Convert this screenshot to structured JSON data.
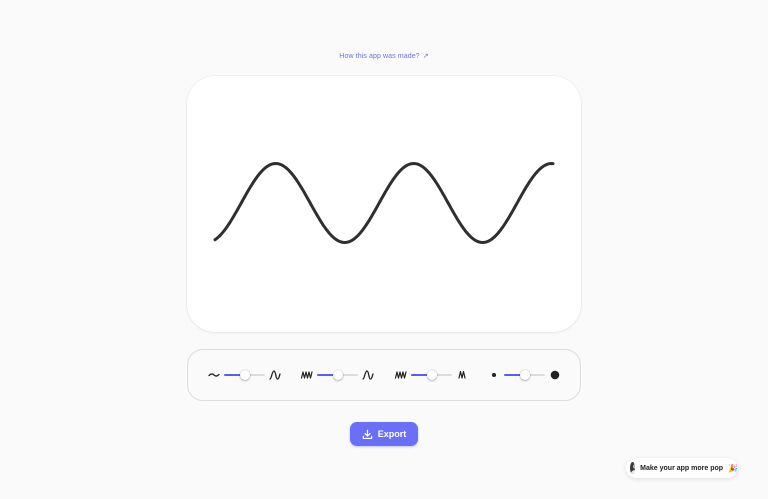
{
  "header": {
    "link_label": "How this app was made?",
    "link_arrow": "↗"
  },
  "canvas": {
    "wave_color": "#2f2f2f",
    "background": "#ffffff"
  },
  "controls": [
    {
      "name": "smoothness",
      "left_icon": "flat-wave-icon",
      "right_icon": "single-peak-icon",
      "value": 0.5
    },
    {
      "name": "frequency",
      "left_icon": "dense-wave-icon",
      "right_icon": "sparse-wave-icon",
      "value": 0.5
    },
    {
      "name": "amplitude",
      "left_icon": "tall-wave-icon",
      "right_icon": "short-wave-icon",
      "value": 0.5
    },
    {
      "name": "stroke-width",
      "left_icon": "small-dot-icon",
      "right_icon": "large-dot-icon",
      "value": 0.5
    }
  ],
  "accent_color": "#5b5ff0",
  "export": {
    "label": "Export",
    "icon": "download-icon"
  },
  "promo": {
    "text": "Make your app more pop",
    "emoji": "🎉"
  }
}
